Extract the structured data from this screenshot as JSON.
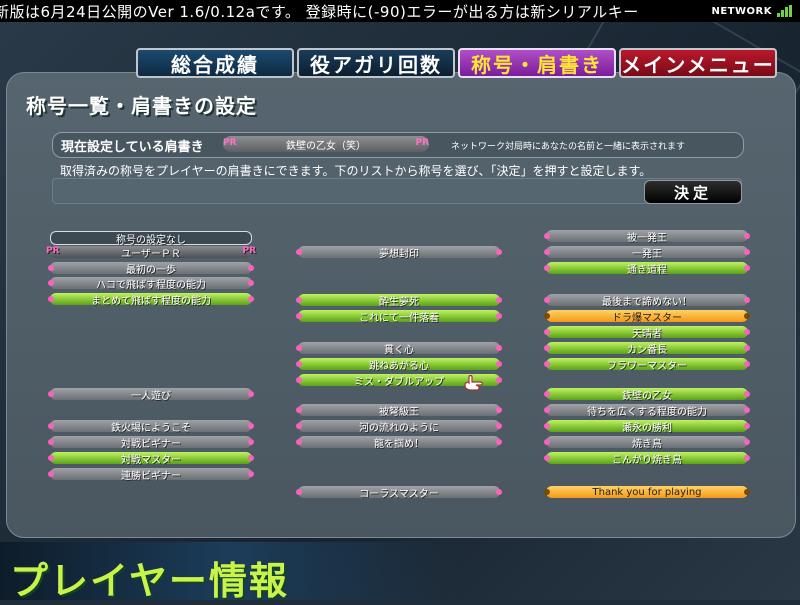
{
  "ticker": {
    "text": "新版は6月24日公開のVer 1.6/0.12aです。    登録時に(-90)エラーが出る方は新シリアルキー",
    "network_label": "NETWORK"
  },
  "tabs": [
    {
      "label": "総合成績"
    },
    {
      "label": "役アガリ回数"
    },
    {
      "label": "称号・肩書き"
    },
    {
      "label": "メインメニュー"
    }
  ],
  "page_title": "称号一覧・肩書きの設定",
  "current": {
    "label": "現在設定している肩書き",
    "pr_left": "PR",
    "value": "鉄壁の乙女（笑）",
    "pr_right": "PR",
    "note": "ネットワーク対局時にあなたの名前と一緒に表示されます"
  },
  "instruction": "取得済みの称号をプレイヤーの肩書きにできます。下のリストから称号を選び、「決定」を押すと設定します。",
  "decide_label": "決定",
  "titles": {
    "left": [
      {
        "label": "称号の設定なし",
        "style": "none"
      },
      {
        "label": "ユーザーＰＲ",
        "style": "pr"
      },
      {
        "label": "最初の一歩",
        "style": "gray"
      },
      {
        "label": "ハコで飛ばす程度の能力",
        "style": "gray"
      },
      {
        "label": "まとめて飛ばす程度の能力",
        "style": "green"
      },
      {
        "label": "一人遊び",
        "style": "gray"
      },
      {
        "label": "鉄火場にようこそ",
        "style": "gray"
      },
      {
        "label": "対戦ビギナー",
        "style": "gray"
      },
      {
        "label": "対戦マスター",
        "style": "green"
      },
      {
        "label": "連勝ビギナー",
        "style": "gray"
      }
    ],
    "middle": [
      {
        "label": "夢想封印",
        "style": "gray"
      },
      {
        "label": "酔生夢死",
        "style": "green"
      },
      {
        "label": "これにて一件落着",
        "style": "green"
      },
      {
        "label": "貫く心",
        "style": "gray"
      },
      {
        "label": "跳ねあがる心",
        "style": "green"
      },
      {
        "label": "ミス・ダブルアップ",
        "style": "green"
      },
      {
        "label": "被弩級王",
        "style": "gray"
      },
      {
        "label": "河の流れのように",
        "style": "gray"
      },
      {
        "label": "龍を掴め！",
        "style": "gray"
      },
      {
        "label": "コーラスマスター",
        "style": "gray"
      }
    ],
    "right": [
      {
        "label": "被一発王",
        "style": "gray"
      },
      {
        "label": "一発王",
        "style": "gray"
      },
      {
        "label": "通き道程",
        "style": "green"
      },
      {
        "label": "最後まで諦めない！",
        "style": "gray"
      },
      {
        "label": "ドラ爆マスター",
        "style": "orange"
      },
      {
        "label": "天晴者",
        "style": "green"
      },
      {
        "label": "カン番長",
        "style": "green"
      },
      {
        "label": "フラワーマスター",
        "style": "green"
      },
      {
        "label": "鉄壁の乙女",
        "style": "green"
      },
      {
        "label": "待ちを広くする程度の能力",
        "style": "gray"
      },
      {
        "label": "瀬永の勝利",
        "style": "green"
      },
      {
        "label": "焼き鳥",
        "style": "gray"
      },
      {
        "label": "こんがり焼き鳥",
        "style": "green"
      },
      {
        "label": "Thank you for playing",
        "style": "orange"
      }
    ]
  },
  "footer_title": "プレイヤー情報",
  "colors": {
    "accent_green": "#c9f24a",
    "accent_pink": "#ff5fbf",
    "accent_orange": "#f49a16"
  }
}
